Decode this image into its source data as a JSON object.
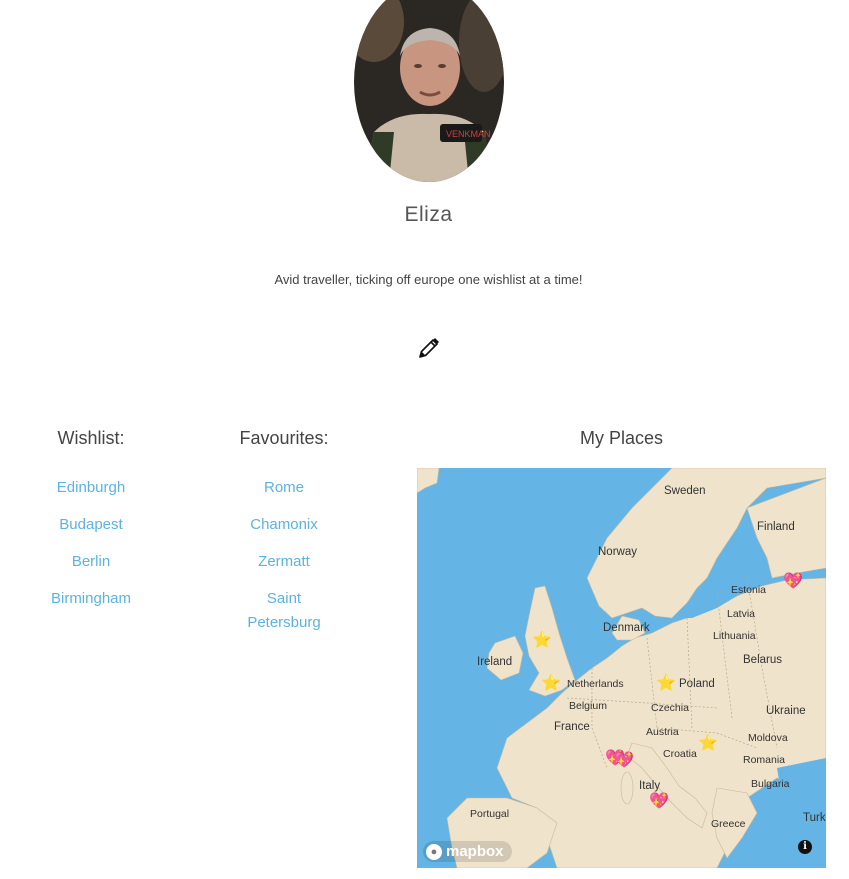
{
  "profile": {
    "name": "Eliza",
    "bio": "Avid traveller, ticking off europe one wishlist at a time!",
    "avatar_icon": "user-photo"
  },
  "wishlist": {
    "title": "Wishlist:",
    "items": [
      "Edinburgh",
      "Budapest",
      "Berlin",
      "Birmingham"
    ]
  },
  "favourites": {
    "title": "Favourites:",
    "items": [
      "Rome",
      "Chamonix",
      "Zermatt",
      "Saint Petersburg"
    ]
  },
  "map": {
    "title": "My Places",
    "water_color": "#64b5e5",
    "land_color": "#f0e3cb",
    "countries": [
      "Sweden",
      "Finland",
      "Norway",
      "Estonia",
      "Latvia",
      "Lithuania",
      "Denmark",
      "Belarus",
      "Ireland",
      "Netherlands",
      "Poland",
      "Belgium",
      "Czechia",
      "Ukraine",
      "France",
      "Austria",
      "Moldova",
      "Croatia",
      "Romania",
      "Bulgaria",
      "Italy",
      "Portugal",
      "Greece",
      "Turk"
    ],
    "provider_logo": "mapbox",
    "info_label": "i",
    "wishlist_marker_icon": "star-icon",
    "favourite_marker_icon": "heart-icon"
  }
}
